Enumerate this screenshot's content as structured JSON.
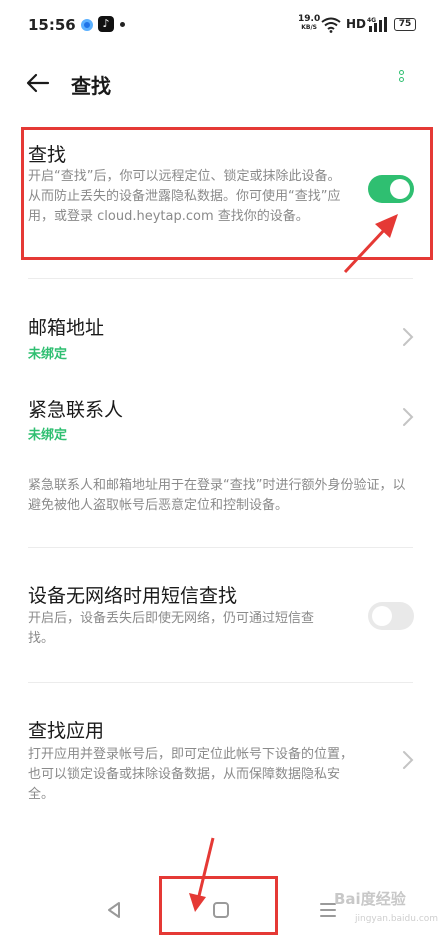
{
  "status_bar": {
    "time": "15:56",
    "net_speed_value": "19.0",
    "net_speed_unit": "KB/S",
    "network_type": "HD",
    "battery": "75",
    "icons": [
      "blue-app-icon",
      "tiktok-icon",
      "notification-dot",
      "wifi-icon",
      "signal-icon",
      "battery-icon"
    ]
  },
  "header": {
    "title": "查找"
  },
  "find_section": {
    "title": "查找",
    "description": "开启“查找”后，你可以远程定位、锁定或抹除此设备。从而防止丢失的设备泄露隐私数据。你可使用“查找”应用，或登录 cloud.heytap.com 查找你的设备。",
    "toggle_on": true
  },
  "email": {
    "title": "邮箱地址",
    "status": "未绑定"
  },
  "emergency_contact": {
    "title": "紧急联系人",
    "status": "未绑定"
  },
  "verification_note": "紧急联系人和邮箱地址用于在登录“查找”时进行额外身份验证，以避免被他人盗取帐号后恶意定位和控制设备。",
  "sms_find": {
    "title": "设备无网络时用短信查找",
    "description": "开启后，设备丢失后即使无网络，仍可通过短信查找。",
    "toggle_on": false
  },
  "find_app": {
    "title": "查找应用",
    "description": "打开应用并登录帐号后，即可定位此帐号下设备的位置，也可以锁定设备或抹除设备数据，从而保障数据隐私安全。"
  },
  "watermark": {
    "brand": "Bai度经验",
    "url": "jingyan.baidu.com"
  },
  "colors": {
    "accent": "#2fbf71",
    "annotation": "#e53935",
    "text_secondary": "#8a8a8a"
  }
}
